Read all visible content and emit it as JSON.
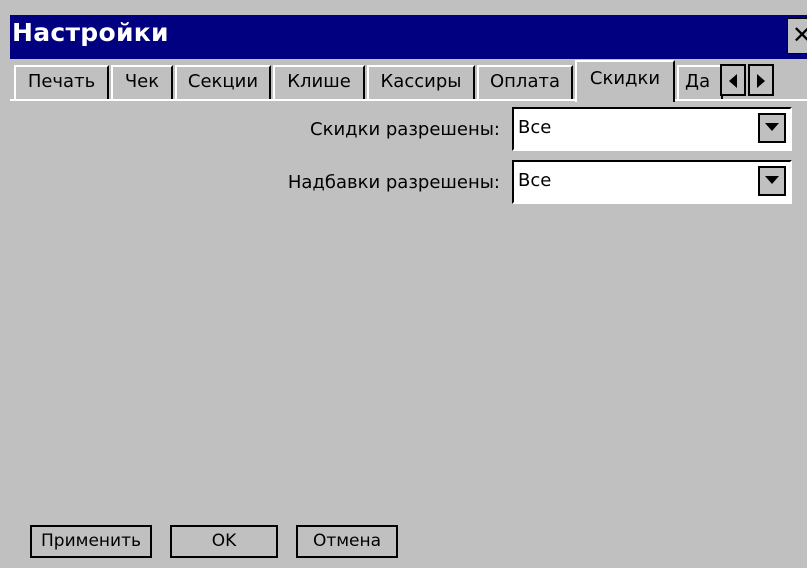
{
  "window": {
    "title": "Настройки",
    "close_symbol": "✕"
  },
  "tabs": [
    {
      "label": "Печать",
      "active": false
    },
    {
      "label": "Чек",
      "active": false
    },
    {
      "label": "Секции",
      "active": false
    },
    {
      "label": "Клише",
      "active": false
    },
    {
      "label": "Кассиры",
      "active": false
    },
    {
      "label": "Оплата",
      "active": false
    },
    {
      "label": "Скидки",
      "active": true
    },
    {
      "label": "Да",
      "active": false
    }
  ],
  "fields": {
    "discounts": {
      "label": "Скидки разрешены:",
      "value": "Все"
    },
    "markups": {
      "label": "Надбавки разрешены:",
      "value": "Все"
    }
  },
  "buttons": {
    "apply": "Применить",
    "ok": "OK",
    "cancel": "Отмена"
  },
  "colors": {
    "titlebar": "#000080",
    "face": "#c0c0c0",
    "field": "#ffffff"
  },
  "icons": [
    "close-icon",
    "arrow-left-icon",
    "arrow-right-icon",
    "chevron-down-icon"
  ]
}
